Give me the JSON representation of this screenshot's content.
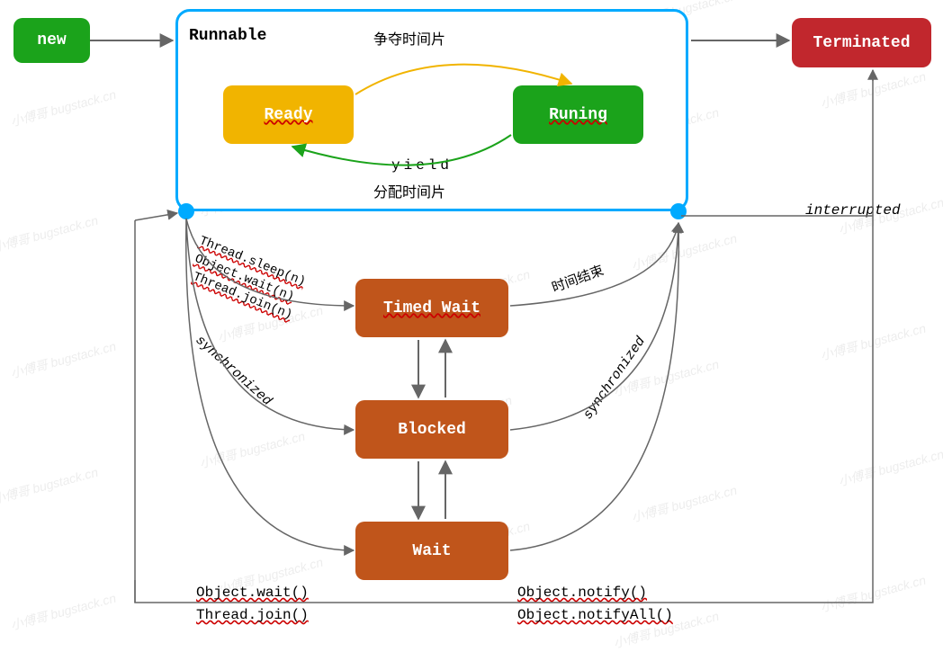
{
  "states": {
    "new": "new",
    "runnable": "Runnable",
    "ready": "Ready",
    "running": "Runing",
    "terminated": "Terminated",
    "timed_wait": "Timed Wait",
    "blocked": "Blocked",
    "wait": "Wait"
  },
  "edges": {
    "compete_timeslice": "争夺时间片",
    "yield": "yield",
    "alloc_timeslice": "分配时间片",
    "interrupted": "interrupted",
    "thread_sleep_n": "Thread.sleep(n)",
    "object_wait_n": "Object.wait(n)",
    "thread_join_n": "Thread.join(n)",
    "synchronized_down": "synchronized",
    "time_over": "时间结束",
    "synchronized_up": "synchronized",
    "object_wait": "Object.wait()",
    "thread_join": "Thread.join()",
    "object_notify": "Object.notify()",
    "object_notifyAll": "Object.notifyAll()"
  },
  "meta": {
    "watermark": "小傅哥 bugstack.cn"
  }
}
